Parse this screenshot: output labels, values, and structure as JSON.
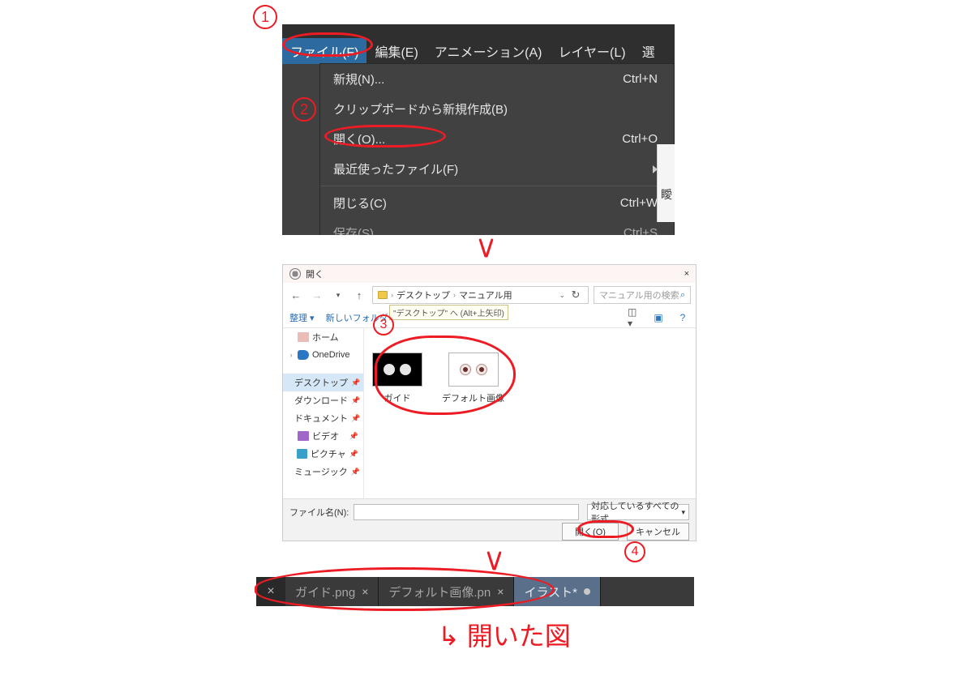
{
  "menu": {
    "menubar": {
      "file": "ファイル(F)",
      "edit": "編集(E)",
      "anim": "アニメーション(A)",
      "layer": "レイヤー(L)",
      "more": "選"
    },
    "items": [
      {
        "label": "新規(N)...",
        "shortcut": "Ctrl+N"
      },
      {
        "label": "クリップボードから新規作成(B)",
        "shortcut": ""
      },
      {
        "label": "開く(O)...",
        "shortcut": "Ctrl+O"
      },
      {
        "label": "最近使ったファイル(F)",
        "shortcut": "",
        "submenu": true
      }
    ],
    "items2": [
      {
        "label": "閉じる(C)",
        "shortcut": "Ctrl+W"
      },
      {
        "label": "保存(S)",
        "shortcut": "Ctrl+S"
      }
    ],
    "right_char": "瞹"
  },
  "filedlg": {
    "title": "開く",
    "close_x": "×",
    "breadcrumb": {
      "part1": "デスクトップ",
      "part2": "マニュアル用"
    },
    "up_tooltip": "\"デスクトップ\" へ (Alt+上矢印)",
    "search_placeholder": "マニュアル用の検索",
    "toolbar": {
      "organize": "整理 ▾",
      "newfolder": "新しいフォルダー"
    },
    "nav": {
      "home": "ホーム",
      "cloud": "OneDrive",
      "desk": "デスクトップ",
      "dl": "ダウンロード",
      "doc": "ドキュメント",
      "vid": "ビデオ",
      "pic": "ピクチャ",
      "mus": "ミュージック"
    },
    "files": [
      {
        "label": "ガイド",
        "kind": "guide"
      },
      {
        "label": "デフォルト画像",
        "kind": "def"
      }
    ],
    "footer": {
      "name_label": "ファイル名(N):",
      "filter": "対応しているすべての形式",
      "open": "開く(O)",
      "cancel": "キャンセル"
    }
  },
  "tabs": {
    "t1": "ガイド.png",
    "t2": "デフォルト画像.pn",
    "t3": "イラスト*"
  },
  "annotations": {
    "n1": "1",
    "n2": "2",
    "n3": "3",
    "n4": "4",
    "opened_text": "↳  開いた図"
  }
}
